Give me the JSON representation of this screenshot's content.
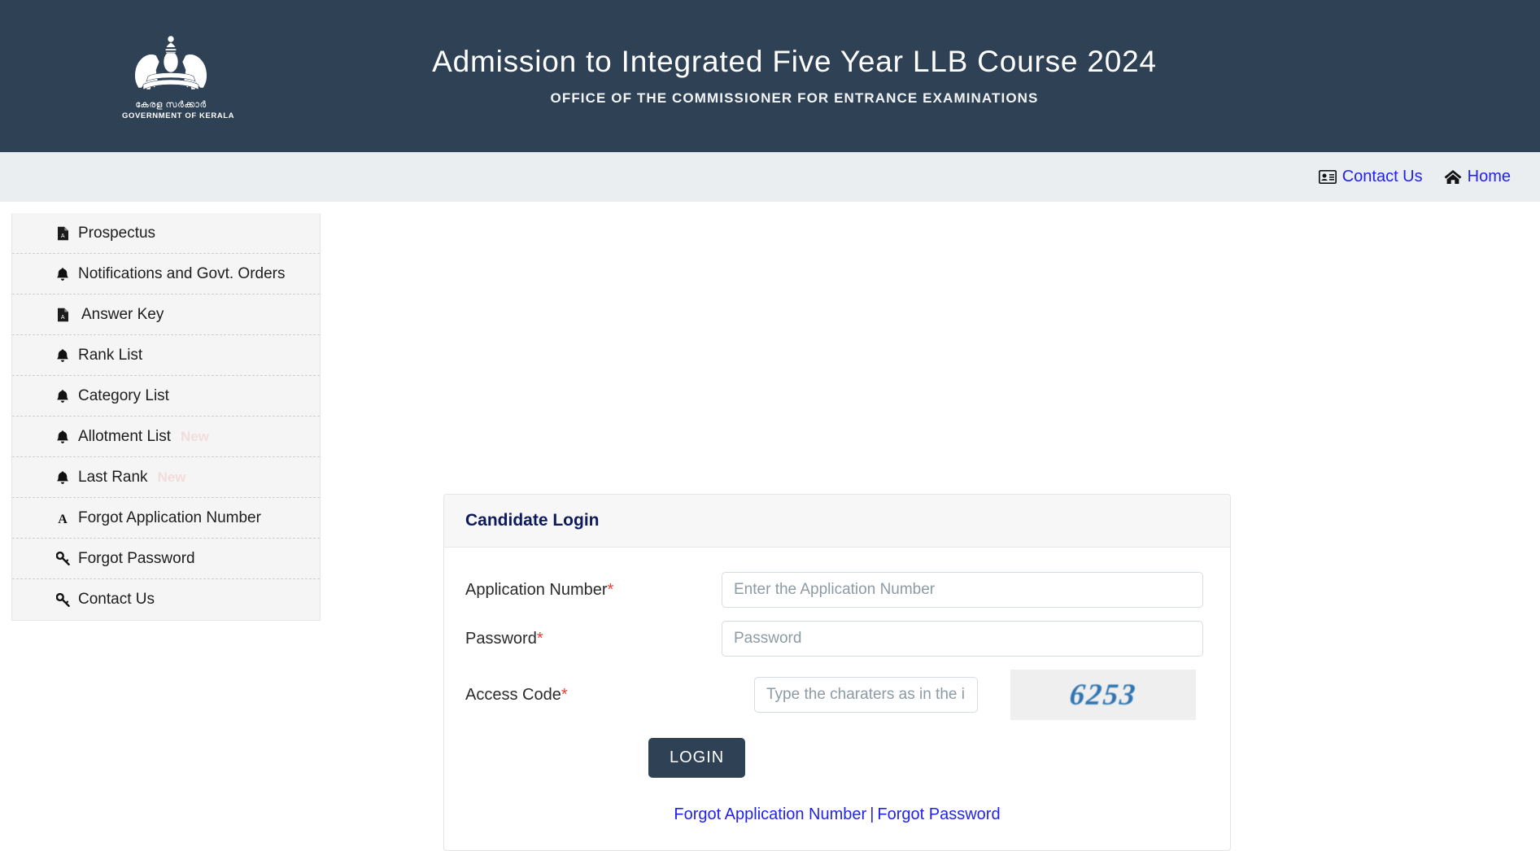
{
  "header": {
    "title": "Admission to Integrated Five Year LLB Course 2024",
    "subtitle": "OFFICE OF THE COMMISSIONER FOR ENTRANCE EXAMINATIONS",
    "emblem": {
      "malayalam": "കേരള സർക്കാർ",
      "english": "GOVERNMENT OF KERALA",
      "icon": "kerala-state-emblem"
    },
    "bg_color": "#2f4154"
  },
  "navbar": {
    "bg_color": "#eaeef0",
    "link_color": "#2222ee",
    "items": [
      {
        "label": "Contact Us",
        "icon": "id-card-icon"
      },
      {
        "label": "Home",
        "icon": "home-icon"
      }
    ]
  },
  "sidebar": {
    "bg_color": "#f5f5f5",
    "items": [
      {
        "label": "Prospectus",
        "icon": "pdf-file-icon",
        "badge": ""
      },
      {
        "label": "Notifications and Govt. Orders",
        "icon": "bell-icon",
        "badge": ""
      },
      {
        "label": "Answer Key",
        "icon": "pdf-file-icon",
        "badge": ""
      },
      {
        "label": "Rank List",
        "icon": "bell-icon",
        "badge": ""
      },
      {
        "label": "Category List",
        "icon": "bell-icon",
        "badge": ""
      },
      {
        "label": "Allotment List",
        "icon": "bell-icon",
        "badge": "New"
      },
      {
        "label": "Last Rank",
        "icon": "bell-icon",
        "badge": "New"
      },
      {
        "label": "Forgot Application Number",
        "icon": "letter-a-icon",
        "badge": ""
      },
      {
        "label": "Forgot Password",
        "icon": "key-icon",
        "badge": ""
      },
      {
        "label": "Contact Us",
        "icon": "key-icon",
        "badge": ""
      }
    ]
  },
  "login": {
    "card_title": "Candidate Login",
    "application_number": {
      "label": "Application Number",
      "required_mark": "*",
      "placeholder": "Enter the Application Number",
      "value": ""
    },
    "password": {
      "label": "Password",
      "required_mark": "*",
      "placeholder": "Password",
      "value": ""
    },
    "access_code": {
      "label": "Access Code",
      "required_mark": "*",
      "placeholder": "Type the charaters as in the in",
      "value": "",
      "captcha_text": "6253",
      "captcha_color": "#2f74b0"
    },
    "submit_label": "LOGIN",
    "submit_color": "#2f4154",
    "links": {
      "forgot_application_number": "Forgot Application Number",
      "separator": "|",
      "forgot_password": "Forgot Password"
    }
  }
}
